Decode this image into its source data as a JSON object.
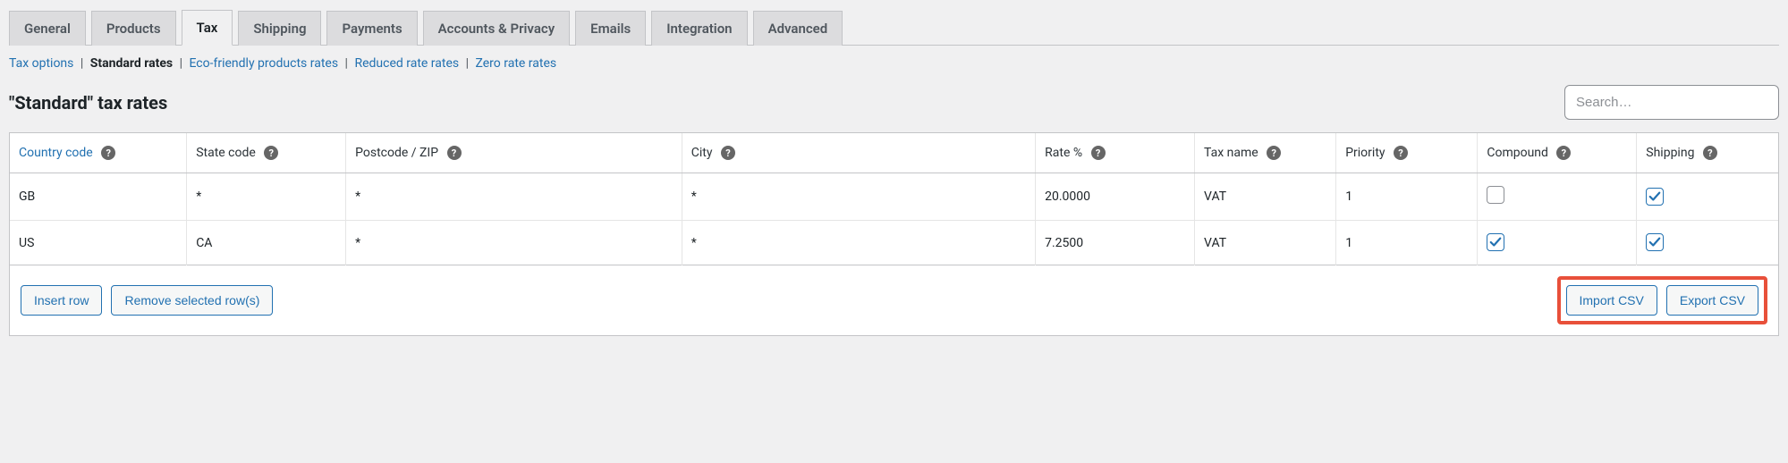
{
  "tabs": [
    {
      "label": "General"
    },
    {
      "label": "Products"
    },
    {
      "label": "Tax",
      "active": true
    },
    {
      "label": "Shipping"
    },
    {
      "label": "Payments"
    },
    {
      "label": "Accounts & Privacy"
    },
    {
      "label": "Emails"
    },
    {
      "label": "Integration"
    },
    {
      "label": "Advanced"
    }
  ],
  "subsub": {
    "tax_options": "Tax options",
    "standard_rates": "Standard rates",
    "eco_rates": "Eco-friendly products rates",
    "reduced_rates": "Reduced rate rates",
    "zero_rates": "Zero rate rates",
    "sep": "|"
  },
  "heading": "\"Standard\" tax rates",
  "search": {
    "placeholder": "Search…"
  },
  "columns": {
    "country": "Country code",
    "state": "State code",
    "postcode": "Postcode / ZIP",
    "city": "City",
    "rate": "Rate %",
    "name": "Tax name",
    "priority": "Priority",
    "compound": "Compound",
    "shipping": "Shipping"
  },
  "rows": [
    {
      "country": "GB",
      "state": "*",
      "postcode": "*",
      "city": "*",
      "rate": "20.0000",
      "name": "VAT",
      "priority": "1",
      "compound": false,
      "shipping": true
    },
    {
      "country": "US",
      "state": "CA",
      "postcode": "*",
      "city": "*",
      "rate": "7.2500",
      "name": "VAT",
      "priority": "1",
      "compound": true,
      "shipping": true
    }
  ],
  "footer": {
    "insert": "Insert row",
    "remove": "Remove selected row(s)",
    "import": "Import CSV",
    "export": "Export CSV"
  },
  "help_glyph": "?"
}
